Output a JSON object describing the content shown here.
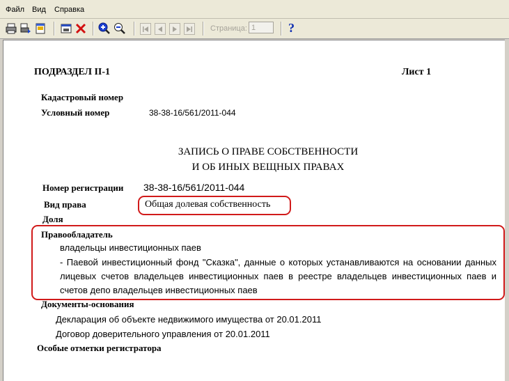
{
  "menu": [
    "Файл",
    "Вид",
    "Справка"
  ],
  "toolbar": {
    "page_label": "Страница:",
    "page_value": "1",
    "help": "?"
  },
  "doc": {
    "subsection": "ПОДРАЗДЕЛ II-1",
    "sheet": "Лист 1",
    "cadastral_label": "Кадастровый номер",
    "conditional_label": "Условный номер",
    "conditional_value": "38-38-16/561/2011-044",
    "title_line1": "ЗАПИСЬ О ПРАВЕ СОБСТВЕННОСТИ",
    "title_line2": "И ОБ ИНЫХ ВЕЩНЫХ ПРАВАХ",
    "reg_label": "Номер регистрации",
    "reg_value": "38-38-16/561/2011-044",
    "right_label": "Вид права",
    "right_value": "Общая долевая собственность",
    "share_label": "Доля",
    "holder_label": "Правообладатель",
    "holder_line1": "владельцы инвестиционных паев",
    "holder_text": "- Паевой инвестиционный фонд \"Сказка\", данные о которых устанавливаются на основании данных лицевых счетов владельцев инвестиционных паев в реестре владельцев инвестиционных паев и счетов депо владельцев инвестиционных паев",
    "docs_label": "Документы-основания",
    "doc1": "Декларация об объекте недвижимого имущества от 20.01.2011",
    "doc2": "Договор доверительного управления от 20.01.2011",
    "notes_label": "Особые отметки регистратора"
  },
  "colors": {
    "highlight": "#d11a1a",
    "help": "#0a2ab0"
  }
}
